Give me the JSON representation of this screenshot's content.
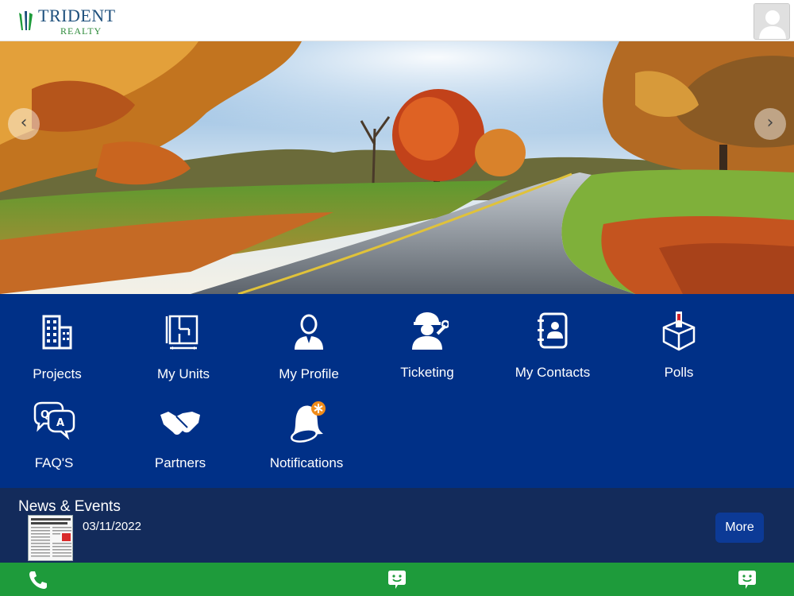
{
  "header": {
    "logo_title": "TRIDENT",
    "logo_subtitle": "REALTY",
    "avatar_icon": "user-avatar-icon"
  },
  "banner": {
    "prev_label": "‹",
    "next_label": "›"
  },
  "menu": {
    "items": [
      {
        "label": "Projects",
        "icon": "buildings-icon"
      },
      {
        "label": "My Units",
        "icon": "floor-plan-icon"
      },
      {
        "label": "My Profile",
        "icon": "person-icon"
      },
      {
        "label": "Ticketing",
        "icon": "technician-icon"
      },
      {
        "label": "My Contacts",
        "icon": "contact-book-icon"
      },
      {
        "label": "Polls",
        "icon": "ballot-box-icon"
      },
      {
        "label": "FAQ'S",
        "icon": "qa-bubbles-icon"
      },
      {
        "label": "Partners",
        "icon": "handshake-icon"
      },
      {
        "label": "Notifications",
        "icon": "bell-icon"
      }
    ]
  },
  "news": {
    "title": "News & Events",
    "date": "03/11/2022",
    "more_label": "More"
  },
  "bottombar": {
    "items": [
      {
        "icon": "phone-icon"
      },
      {
        "icon": "chat-icon"
      },
      {
        "icon": "chat-icon"
      }
    ]
  },
  "colors": {
    "menu_bg": "#003087",
    "news_bg": "#132b5b",
    "bottombar_bg": "#1e9b3b",
    "button_bg": "#0c3a96"
  }
}
